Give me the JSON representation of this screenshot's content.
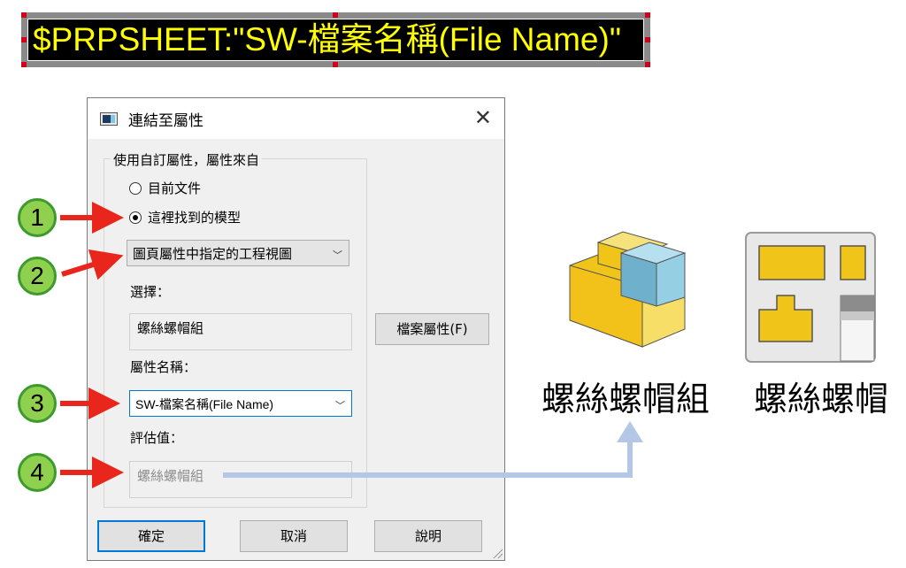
{
  "banner": {
    "text": "$PRPSHEET:\"SW-檔案名稱(File Name)\""
  },
  "dialog": {
    "title": "連結至屬性",
    "close_glyph": "✕",
    "group_legend": "使用自訂屬性，屬性來自",
    "radio_current_doc": "目前文件",
    "radio_model_found": "這裡找到的模型",
    "view_dropdown": "圖頁屬性中指定的工程視圖",
    "select_label": "選擇：",
    "select_value": "螺絲螺帽組",
    "file_props_button": "檔案屬性(F)",
    "prop_name_label": "屬性名稱：",
    "prop_name_value": "SW-檔案名稱(File Name)",
    "eval_label": "評估值：",
    "eval_value": "螺絲螺帽組",
    "ok": "確定",
    "cancel": "取消",
    "help": "說明"
  },
  "callouts": [
    "1",
    "2",
    "3",
    "4"
  ],
  "right": {
    "assembly_label": "螺絲螺帽組",
    "drawing_label": "螺絲螺帽"
  },
  "colors": {
    "banner_text": "#ffff00",
    "callout_fill": "#8fd14f",
    "arrow_red": "#e8261c",
    "flow_line": "#b4c7e7"
  }
}
